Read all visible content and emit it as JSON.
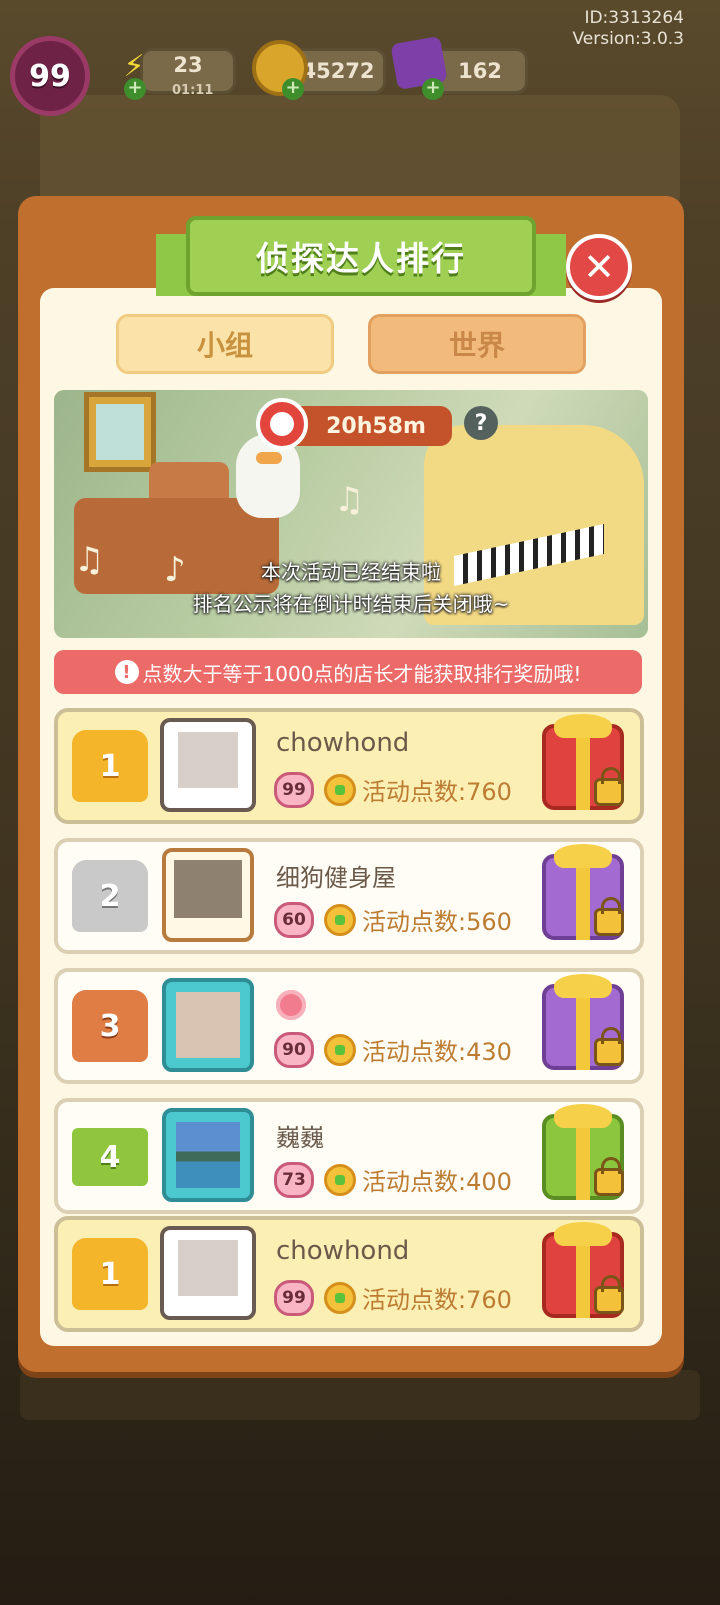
{
  "meta": {
    "id_text": "ID:3313264",
    "version_text": "Version:3.0.3"
  },
  "hud": {
    "level": "99",
    "energy": "23",
    "energy_timer": "01:11",
    "coins": "45272",
    "gems": "162",
    "plus_glyph": "+"
  },
  "modal": {
    "title": "侦探达人排行",
    "close_glyph": "✕",
    "tabs": [
      {
        "label": "小组"
      },
      {
        "label": "世界"
      }
    ],
    "banner": {
      "countdown": "20h58m",
      "help_glyph": "?",
      "message_line1": "本次活动已经结束啦",
      "message_line2": "排名公示将在倒计时结束后关闭哦~"
    },
    "notice": {
      "icon_glyph": "!",
      "text": "点数大于等于1000点的店长才能获取排行奖励哦!"
    }
  },
  "leaderboard": [
    {
      "rank": "1",
      "name": "chowhond",
      "level": "99",
      "points": "活动点数:760",
      "gift_color": "red"
    },
    {
      "rank": "2",
      "name": "细狗健身屋",
      "level": "60",
      "points": "活动点数:560",
      "gift_color": "purple"
    },
    {
      "rank": "3",
      "name": "",
      "level": "90",
      "points": "活动点数:430",
      "gift_color": "purple"
    },
    {
      "rank": "4",
      "name": "巍巍",
      "level": "73",
      "points": "活动点数:400",
      "gift_color": "green"
    }
  ],
  "my_entry": {
    "rank": "1",
    "name": "chowhond",
    "level": "99",
    "points": "活动点数:760",
    "gift_color": "red"
  },
  "colors": {
    "modal_frame": "#c06f2f",
    "ribbon_green": "#9fd054",
    "notice_red": "#ec6b68",
    "close_red": "#e24845"
  },
  "icons": [
    "clock-icon",
    "help-icon",
    "close-icon",
    "crown-icon",
    "gift-icon",
    "lock-icon",
    "heart-level-icon",
    "clover-points-icon",
    "energy-icon",
    "coin-icon",
    "gem-icon"
  ]
}
